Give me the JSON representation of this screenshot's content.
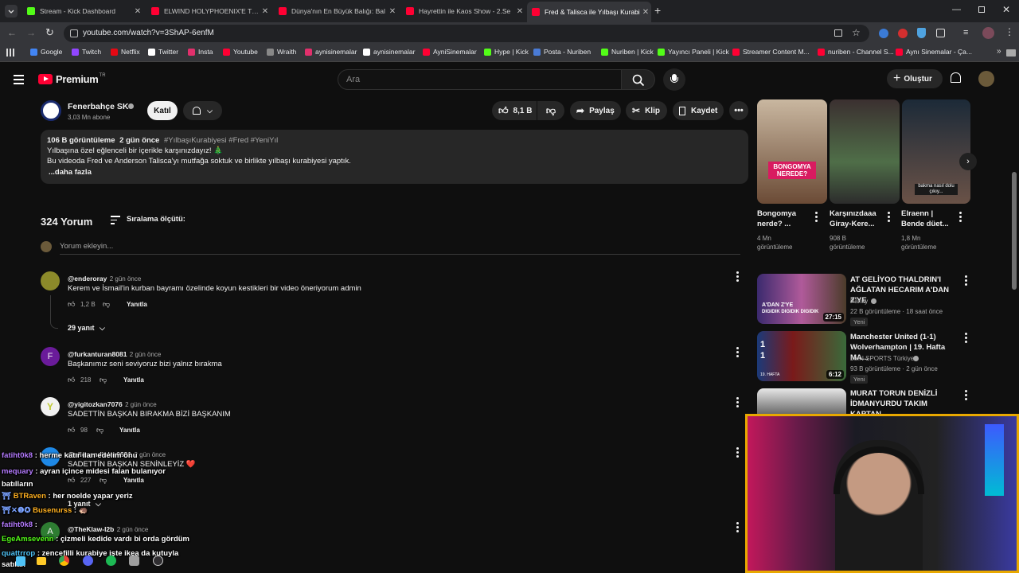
{
  "tabs": [
    {
      "label": "Stream - Kick Dashboard",
      "color": "#53fc18"
    },
    {
      "label": "ELWIND HOLYPHOENIX'E TEK A",
      "color": "#ff0033"
    },
    {
      "label": "Dünya'nın En Büyük Balığı: Bal",
      "color": "#ff0033"
    },
    {
      "label": "Hayrettin ile Kaos Show - 2.Se",
      "color": "#ff0033"
    },
    {
      "label": "Fred & Talisca ile Yılbaşı Kurabi",
      "color": "#ff0033"
    }
  ],
  "address": {
    "url": "youtube.com/watch?v=3ShAP-6enfM"
  },
  "bookmarks": [
    {
      "label": "Google",
      "color": "#4285f4"
    },
    {
      "label": "Twitch",
      "color": "#9146ff"
    },
    {
      "label": "Netflix",
      "color": "#e50914"
    },
    {
      "label": "Twitter",
      "color": "#ffffff"
    },
    {
      "label": "Insta",
      "color": "#e1306c"
    },
    {
      "label": "Youtube",
      "color": "#ff0033"
    },
    {
      "label": "Wraith",
      "color": "#888888"
    },
    {
      "label": "aynisinemalar",
      "color": "#e1306c"
    },
    {
      "label": "aynisinemalar",
      "color": "#ffffff"
    },
    {
      "label": "AyniSinemalar",
      "color": "#ff0033"
    },
    {
      "label": "Hype | Kick",
      "color": "#53fc18"
    },
    {
      "label": "Posta - Nuriben",
      "color": "#4a7bd6"
    },
    {
      "label": "Nuriben | Kick",
      "color": "#53fc18"
    },
    {
      "label": "Yayıncı Paneli | Kick",
      "color": "#53fc18"
    },
    {
      "label": "Streamer Content M...",
      "color": "#ff0033"
    },
    {
      "label": "nuriben - Channel S...",
      "color": "#ff0033"
    },
    {
      "label": "Aynı Sinemalar - Ça...",
      "color": "#ff0033"
    }
  ],
  "header": {
    "logo_text": "Premium",
    "logo_sup": "TR",
    "search_placeholder": "Ara",
    "create_label": "Oluştur"
  },
  "channel": {
    "name": "Fenerbahçe SK",
    "subs": "3,03 Mn abone",
    "join_label": "Katıl",
    "likes": "8,1 B",
    "share_label": "Paylaş",
    "clip_label": "Klip",
    "save_label": "Kaydet"
  },
  "description": {
    "views": "106 B görüntüleme",
    "age": "2 gün önce",
    "tags": "#YılbaşıKurabiyesi #Fred #YeniYıl",
    "line1": "Yılbaşına özel eğlenceli bir içerikle karşınızdayız! 🎄",
    "line2": "Bu videoda Fred ve Anderson Talisca'yı mutfağa soktuk ve birlikte yılbaşı kurabiyesi yaptık.",
    "more": "...daha fazla"
  },
  "comments_header": {
    "count": "324 Yorum",
    "sort_label": "Sıralama ölçütü:",
    "add_placeholder": "Yorum ekleyin..."
  },
  "comments": [
    {
      "author": "@enderoray",
      "age": "2 gün önce",
      "text": "Kerem ve İsmail'in kurban bayramı özelinde koyun kestikleri bir video öneriyorum admin",
      "likes": "1,2 B",
      "reply": "Yanıtla",
      "replies": "29 yanıt",
      "avatar": "#8c8a2a"
    },
    {
      "author": "@furkanturan8081",
      "age": "2 gün önce",
      "text": "Başkanımız seni seviyoruz bizi yalnız bırakma",
      "likes": "218",
      "reply": "Yanıtla",
      "avatar_letter": "F",
      "avatar": "#6a1b9a"
    },
    {
      "author": "@yigitozkan7076",
      "age": "2 gün önce",
      "text": "SADETTİN BAŞKAN BIRAKMA BİZİ BAŞKANIM",
      "likes": "98",
      "reply": "Yanıtla",
      "avatar_letter": "Y",
      "avatar": "#c0ca33"
    },
    {
      "author": "@alienandinlor6691",
      "age": "2 gün önce",
      "text": "SADETTİN BAŞKAN SENİNLEYİZ ❤️",
      "likes": "227",
      "reply": "Yanıtla",
      "replies": "1 yanıt",
      "avatar": "#1e88e5"
    },
    {
      "author": "@TheKlaw-l2b",
      "age": "2 gün önce",
      "text": "",
      "avatar_letter": "A",
      "avatar": "#2e7d32"
    }
  ],
  "related": [
    {
      "title": "Bongomya nerde? ...",
      "meta1": "4 Mn",
      "meta2": "görüntüleme",
      "thumb_text": "BONGOMYA NEREDE?"
    },
    {
      "title": "Karşınızdaaa Giray-Kere...",
      "meta1": "908 B",
      "meta2": "görüntüleme"
    },
    {
      "title": "Elraenn | Bende düet...",
      "meta1": "1,8 Mn",
      "meta2": "görüntüleme",
      "thumb_text": "bakma nasıl dolu çıkıy..."
    }
  ],
  "videos": [
    {
      "title": "AT GELİYOO THALDRIN'I AĞLATAN HECARIM A'DAN Z'YE",
      "channel": "Panky",
      "meta": "22 B görüntüleme · 18 saat önce",
      "badge": "Yeni",
      "duration": "27:15",
      "thumb_text": "A'DAN Z'YE",
      "thumb_text2": "DIGIDIK DIGIDIK DIGIDIK"
    },
    {
      "title": "Manchester United (1-1) Wolverhampton | 19. Hafta MA...",
      "channel": "beIN SPORTS Türkiye",
      "meta": "93 B görüntüleme · 2 gün önce",
      "badge": "Yeni",
      "duration": "6:12",
      "thumb_text": "19. HAFTA"
    },
    {
      "title": "MURAT TORUN DENİZLİ İDMANYURDU TAKIM KAPTAN...",
      "channel": "",
      "meta": "",
      "badge": ""
    }
  ],
  "chat": [
    {
      "user": "fatiht0k8",
      "msg": "herme katır ilan edelim onu",
      "color": "#b57bff"
    },
    {
      "user": "mequary",
      "msg": "ayran içince midesi falan bulanıyor batılların",
      "color": "#b57bff"
    },
    {
      "user": "BTRaven",
      "msg": "her noelde yapar yeriz",
      "color": "#ffb020"
    },
    {
      "user": "Busenurss",
      "msg": "🦔",
      "color": "#ffb020"
    },
    {
      "user": "fatiht0k8",
      "msg": "",
      "color": "#b57bff"
    },
    {
      "user": "EgeAmsevenn",
      "msg": "çizmeli kedide vardı bi orda gördüm",
      "color": "#53fc18"
    },
    {
      "user": "quattrrop",
      "msg": "zencefilli kurabiye işte ikea da kutuyla satılan",
      "color": "#4fc3f7"
    }
  ]
}
